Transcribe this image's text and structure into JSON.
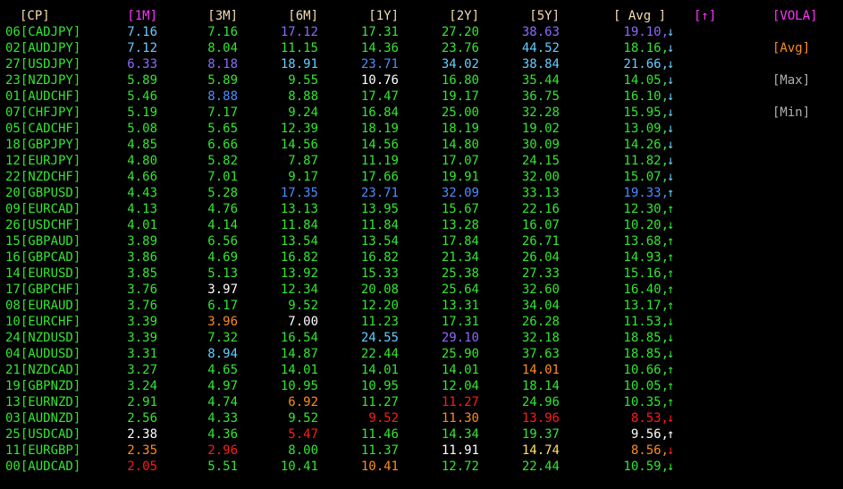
{
  "colors": {
    "background": "#000000",
    "green": "#33e633",
    "white": "#ffffff",
    "blue": "#4d8cff",
    "purple": "#8a6bff",
    "cyan": "#66ccff",
    "red": "#ff1a1a",
    "orange": "#ff8c1a",
    "yellow": "#ffe066",
    "magenta": "#ff33ff",
    "gray": "#b0b0b0",
    "header": "#f5deb3"
  },
  "header": {
    "cp": "[CP]",
    "m1": "[1M]",
    "m3": "[3M]",
    "m6": "[6M]",
    "y1": "[1Y]",
    "y2": "[2Y]",
    "y5": "[5Y]",
    "avg": "[ Avg ]",
    "sort": "[↑]"
  },
  "side_menu": {
    "vola": "[VOLA]",
    "avg": "[Avg]",
    "max": "[Max]",
    "min": "[Min]"
  },
  "rows": [
    {
      "cp": "06[CADJPY]",
      "m1": "7.16",
      "m3": "7.16",
      "m6": "17.12",
      "y1": "17.31",
      "y2": "27.20",
      "y5": "38.63",
      "avg": "19.10,",
      "arrow": "↓",
      "c": {
        "cp": "green",
        "m1": "cyan",
        "m3": "green",
        "m6": "purple",
        "y1": "green",
        "y2": "green",
        "y5": "purple",
        "avg": "purple",
        "arrow": "cyan"
      }
    },
    {
      "cp": "02[AUDJPY]",
      "m1": "7.12",
      "m3": "8.04",
      "m6": "11.15",
      "y1": "14.36",
      "y2": "23.76",
      "y5": "44.52",
      "avg": "18.16,",
      "arrow": "↓",
      "c": {
        "cp": "green",
        "m1": "cyan",
        "m3": "green",
        "m6": "green",
        "y1": "green",
        "y2": "green",
        "y5": "cyan",
        "avg": "green",
        "arrow": "cyan"
      }
    },
    {
      "cp": "27[USDJPY]",
      "m1": "6.33",
      "m3": "8.18",
      "m6": "18.91",
      "y1": "23.71",
      "y2": "34.02",
      "y5": "38.84",
      "avg": "21.66,",
      "arrow": "↓",
      "c": {
        "cp": "green",
        "m1": "purple",
        "m3": "purple",
        "m6": "cyan",
        "y1": "blue",
        "y2": "cyan",
        "y5": "cyan",
        "avg": "cyan",
        "arrow": "cyan"
      }
    },
    {
      "cp": "23[NZDJPY]",
      "m1": "5.89",
      "m3": "5.89",
      "m6": "9.55",
      "y1": "10.76",
      "y2": "16.80",
      "y5": "35.44",
      "avg": "14.05,",
      "arrow": "↓",
      "c": {
        "cp": "green",
        "m1": "green",
        "m3": "green",
        "m6": "green",
        "y1": "white",
        "y2": "green",
        "y5": "green",
        "avg": "green",
        "arrow": "cyan"
      }
    },
    {
      "cp": "01[AUDCHF]",
      "m1": "5.46",
      "m3": "8.88",
      "m6": "8.88",
      "y1": "17.47",
      "y2": "19.17",
      "y5": "36.75",
      "avg": "16.10,",
      "arrow": "↓",
      "c": {
        "cp": "green",
        "m1": "green",
        "m3": "blue",
        "m6": "green",
        "y1": "green",
        "y2": "green",
        "y5": "green",
        "avg": "green",
        "arrow": "cyan"
      }
    },
    {
      "cp": "07[CHFJPY]",
      "m1": "5.19",
      "m3": "7.17",
      "m6": "9.24",
      "y1": "16.84",
      "y2": "25.00",
      "y5": "32.28",
      "avg": "15.95,",
      "arrow": "↓",
      "c": {
        "cp": "green",
        "m1": "green",
        "m3": "green",
        "m6": "green",
        "y1": "green",
        "y2": "green",
        "y5": "green",
        "avg": "green",
        "arrow": "cyan"
      }
    },
    {
      "cp": "05[CADCHF]",
      "m1": "5.08",
      "m3": "5.65",
      "m6": "12.39",
      "y1": "18.19",
      "y2": "18.19",
      "y5": "19.02",
      "avg": "13.09,",
      "arrow": "↓",
      "c": {
        "cp": "green",
        "m1": "green",
        "m3": "green",
        "m6": "green",
        "y1": "green",
        "y2": "green",
        "y5": "green",
        "avg": "green",
        "arrow": "cyan"
      }
    },
    {
      "cp": "18[GBPJPY]",
      "m1": "4.85",
      "m3": "6.66",
      "m6": "14.56",
      "y1": "14.56",
      "y2": "14.80",
      "y5": "30.09",
      "avg": "14.26,",
      "arrow": "↓",
      "c": {
        "cp": "green",
        "m1": "green",
        "m3": "green",
        "m6": "green",
        "y1": "green",
        "y2": "green",
        "y5": "green",
        "avg": "green",
        "arrow": "cyan"
      }
    },
    {
      "cp": "12[EURJPY]",
      "m1": "4.80",
      "m3": "5.82",
      "m6": "7.87",
      "y1": "11.19",
      "y2": "17.07",
      "y5": "24.15",
      "avg": "11.82,",
      "arrow": "↓",
      "c": {
        "cp": "green",
        "m1": "green",
        "m3": "green",
        "m6": "green",
        "y1": "green",
        "y2": "green",
        "y5": "green",
        "avg": "green",
        "arrow": "cyan"
      }
    },
    {
      "cp": "22[NZDCHF]",
      "m1": "4.66",
      "m3": "7.01",
      "m6": "9.17",
      "y1": "17.66",
      "y2": "19.91",
      "y5": "32.00",
      "avg": "15.07,",
      "arrow": "↓",
      "c": {
        "cp": "green",
        "m1": "green",
        "m3": "green",
        "m6": "green",
        "y1": "green",
        "y2": "green",
        "y5": "green",
        "avg": "green",
        "arrow": "cyan"
      }
    },
    {
      "cp": "20[GBPUSD]",
      "m1": "4.43",
      "m3": "5.28",
      "m6": "17.35",
      "y1": "23.71",
      "y2": "32.09",
      "y5": "33.13",
      "avg": "19.33,",
      "arrow": "↑",
      "c": {
        "cp": "green",
        "m1": "green",
        "m3": "green",
        "m6": "blue",
        "y1": "blue",
        "y2": "blue",
        "y5": "green",
        "avg": "blue",
        "arrow": "cyan"
      }
    },
    {
      "cp": "09[EURCAD]",
      "m1": "4.13",
      "m3": "4.76",
      "m6": "13.13",
      "y1": "13.95",
      "y2": "15.67",
      "y5": "22.16",
      "avg": "12.30,",
      "arrow": "↑",
      "c": {
        "cp": "green",
        "m1": "green",
        "m3": "green",
        "m6": "green",
        "y1": "green",
        "y2": "green",
        "y5": "green",
        "avg": "green",
        "arrow": "green"
      }
    },
    {
      "cp": "26[USDCHF]",
      "m1": "4.01",
      "m3": "4.14",
      "m6": "11.84",
      "y1": "11.84",
      "y2": "13.28",
      "y5": "16.07",
      "avg": "10.20,",
      "arrow": "↓",
      "c": {
        "cp": "green",
        "m1": "green",
        "m3": "green",
        "m6": "green",
        "y1": "green",
        "y2": "green",
        "y5": "green",
        "avg": "green",
        "arrow": "green"
      }
    },
    {
      "cp": "15[GBPAUD]",
      "m1": "3.89",
      "m3": "6.56",
      "m6": "13.54",
      "y1": "13.54",
      "y2": "17.84",
      "y5": "26.71",
      "avg": "13.68,",
      "arrow": "↑",
      "c": {
        "cp": "green",
        "m1": "green",
        "m3": "green",
        "m6": "green",
        "y1": "green",
        "y2": "green",
        "y5": "green",
        "avg": "green",
        "arrow": "green"
      }
    },
    {
      "cp": "16[GBPCAD]",
      "m1": "3.86",
      "m3": "4.69",
      "m6": "16.82",
      "y1": "16.82",
      "y2": "21.34",
      "y5": "26.04",
      "avg": "14.93,",
      "arrow": "↑",
      "c": {
        "cp": "green",
        "m1": "green",
        "m3": "green",
        "m6": "green",
        "y1": "green",
        "y2": "green",
        "y5": "green",
        "avg": "green",
        "arrow": "green"
      }
    },
    {
      "cp": "14[EURUSD]",
      "m1": "3.85",
      "m3": "5.13",
      "m6": "13.92",
      "y1": "15.33",
      "y2": "25.38",
      "y5": "27.33",
      "avg": "15.16,",
      "arrow": "↑",
      "c": {
        "cp": "green",
        "m1": "green",
        "m3": "green",
        "m6": "green",
        "y1": "green",
        "y2": "green",
        "y5": "green",
        "avg": "green",
        "arrow": "green"
      }
    },
    {
      "cp": "17[GBPCHF]",
      "m1": "3.76",
      "m3": "3.97",
      "m6": "12.34",
      "y1": "20.08",
      "y2": "25.64",
      "y5": "32.60",
      "avg": "16.40,",
      "arrow": "↑",
      "c": {
        "cp": "green",
        "m1": "green",
        "m3": "white",
        "m6": "green",
        "y1": "green",
        "y2": "green",
        "y5": "green",
        "avg": "green",
        "arrow": "green"
      }
    },
    {
      "cp": "08[EURAUD]",
      "m1": "3.76",
      "m3": "6.17",
      "m6": "9.52",
      "y1": "12.20",
      "y2": "13.31",
      "y5": "34.04",
      "avg": "13.17,",
      "arrow": "↑",
      "c": {
        "cp": "green",
        "m1": "green",
        "m3": "green",
        "m6": "green",
        "y1": "green",
        "y2": "green",
        "y5": "green",
        "avg": "green",
        "arrow": "green"
      }
    },
    {
      "cp": "10[EURCHF]",
      "m1": "3.39",
      "m3": "3.96",
      "m6": "7.00",
      "y1": "11.23",
      "y2": "17.31",
      "y5": "26.28",
      "avg": "11.53,",
      "arrow": "↓",
      "c": {
        "cp": "green",
        "m1": "green",
        "m3": "orange",
        "m6": "white",
        "y1": "green",
        "y2": "green",
        "y5": "green",
        "avg": "green",
        "arrow": "green"
      }
    },
    {
      "cp": "24[NZDUSD]",
      "m1": "3.39",
      "m3": "7.32",
      "m6": "16.54",
      "y1": "24.55",
      "y2": "29.10",
      "y5": "32.18",
      "avg": "18.85,",
      "arrow": "↓",
      "c": {
        "cp": "green",
        "m1": "green",
        "m3": "green",
        "m6": "green",
        "y1": "cyan",
        "y2": "purple",
        "y5": "green",
        "avg": "green",
        "arrow": "green"
      }
    },
    {
      "cp": "04[AUDUSD]",
      "m1": "3.31",
      "m3": "8.94",
      "m6": "14.87",
      "y1": "22.44",
      "y2": "25.90",
      "y5": "37.63",
      "avg": "18.85,",
      "arrow": "↓",
      "c": {
        "cp": "green",
        "m1": "green",
        "m3": "cyan",
        "m6": "green",
        "y1": "green",
        "y2": "green",
        "y5": "green",
        "avg": "green",
        "arrow": "green"
      }
    },
    {
      "cp": "21[NZDCAD]",
      "m1": "3.27",
      "m3": "4.65",
      "m6": "14.01",
      "y1": "14.01",
      "y2": "14.01",
      "y5": "14.01",
      "avg": "10.66,",
      "arrow": "↑",
      "c": {
        "cp": "green",
        "m1": "green",
        "m3": "green",
        "m6": "green",
        "y1": "green",
        "y2": "green",
        "y5": "orange",
        "avg": "green",
        "arrow": "green"
      }
    },
    {
      "cp": "19[GBPNZD]",
      "m1": "3.24",
      "m3": "4.97",
      "m6": "10.95",
      "y1": "10.95",
      "y2": "12.04",
      "y5": "18.14",
      "avg": "10.05,",
      "arrow": "↑",
      "c": {
        "cp": "green",
        "m1": "green",
        "m3": "green",
        "m6": "green",
        "y1": "green",
        "y2": "green",
        "y5": "green",
        "avg": "green",
        "arrow": "green"
      }
    },
    {
      "cp": "13[EURNZD]",
      "m1": "2.91",
      "m3": "4.74",
      "m6": "6.92",
      "y1": "11.27",
      "y2": "11.27",
      "y5": "24.96",
      "avg": "10.35,",
      "arrow": "↑",
      "c": {
        "cp": "green",
        "m1": "green",
        "m3": "green",
        "m6": "orange",
        "y1": "green",
        "y2": "red",
        "y5": "green",
        "avg": "green",
        "arrow": "green"
      }
    },
    {
      "cp": "03[AUDNZD]",
      "m1": "2.56",
      "m3": "4.33",
      "m6": "9.52",
      "y1": "9.52",
      "y2": "11.30",
      "y5": "13.96",
      "avg": "8.53,",
      "arrow": "↓",
      "c": {
        "cp": "green",
        "m1": "green",
        "m3": "green",
        "m6": "green",
        "y1": "red",
        "y2": "orange",
        "y5": "red",
        "avg": "red",
        "arrow": "red"
      }
    },
    {
      "cp": "25[USDCAD]",
      "m1": "2.38",
      "m3": "4.36",
      "m6": "5.47",
      "y1": "11.46",
      "y2": "14.34",
      "y5": "19.37",
      "avg": "9.56,",
      "arrow": "↑",
      "c": {
        "cp": "green",
        "m1": "white",
        "m3": "green",
        "m6": "red",
        "y1": "green",
        "y2": "green",
        "y5": "green",
        "avg": "white",
        "arrow": "white"
      }
    },
    {
      "cp": "11[EURGBP]",
      "m1": "2.35",
      "m3": "2.96",
      "m6": "8.00",
      "y1": "11.37",
      "y2": "11.91",
      "y5": "14.74",
      "avg": "8.56,",
      "arrow": "↓",
      "c": {
        "cp": "green",
        "m1": "orange",
        "m3": "red",
        "m6": "green",
        "y1": "green",
        "y2": "white",
        "y5": "yellow",
        "avg": "orange",
        "arrow": "red"
      }
    },
    {
      "cp": "00[AUDCAD]",
      "m1": "2.05",
      "m3": "5.51",
      "m6": "10.41",
      "y1": "10.41",
      "y2": "12.72",
      "y5": "22.44",
      "avg": "10.59,",
      "arrow": "↓",
      "c": {
        "cp": "green",
        "m1": "red",
        "m3": "green",
        "m6": "green",
        "y1": "orange",
        "y2": "green",
        "y5": "green",
        "avg": "green",
        "arrow": "green"
      }
    }
  ]
}
